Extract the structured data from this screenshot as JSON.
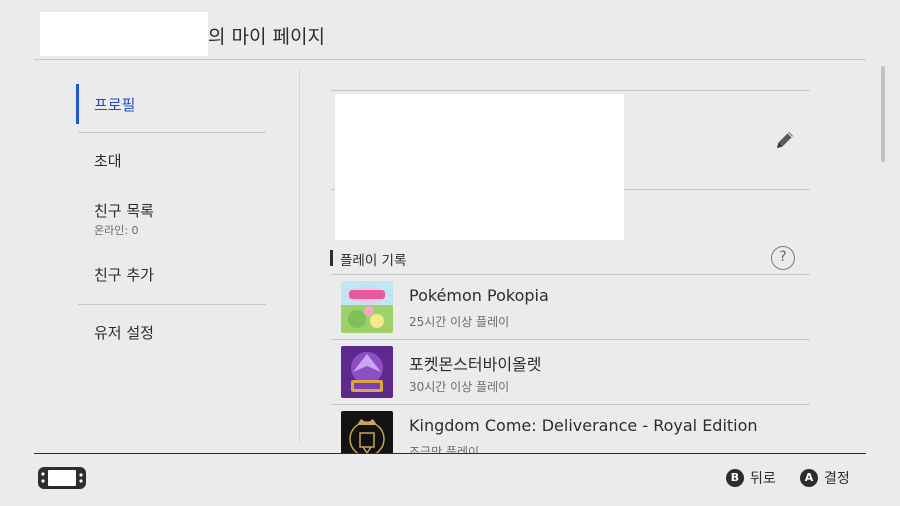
{
  "header": {
    "title": "의 마이 페이지"
  },
  "sidebar": {
    "items": [
      {
        "label": "프로필",
        "active": true
      },
      {
        "label": "초대"
      },
      {
        "label": "친구 목록",
        "sub": "온라인: 0"
      },
      {
        "label": "친구 추가"
      },
      {
        "label": "유저 설정"
      }
    ]
  },
  "profile": {
    "edit_icon": "pencil-icon"
  },
  "play_history": {
    "title": "플레이 기록",
    "help_glyph": "?",
    "games": [
      {
        "title": "Pokémon Pokopia",
        "playtime": "25시간 이상 플레이"
      },
      {
        "title": "포켓몬스터바이올렛",
        "playtime": "30시간 이상 플레이"
      },
      {
        "title": "Kingdom Come: Deliverance - Royal Edition",
        "playtime": "조금만 플레이"
      }
    ]
  },
  "footer": {
    "back": {
      "glyph": "B",
      "label": "뒤로"
    },
    "confirm": {
      "glyph": "A",
      "label": "결정"
    }
  },
  "colors": {
    "accent": "#1d57d6",
    "background": "#ebebeb",
    "text": "#2d2d2d"
  }
}
